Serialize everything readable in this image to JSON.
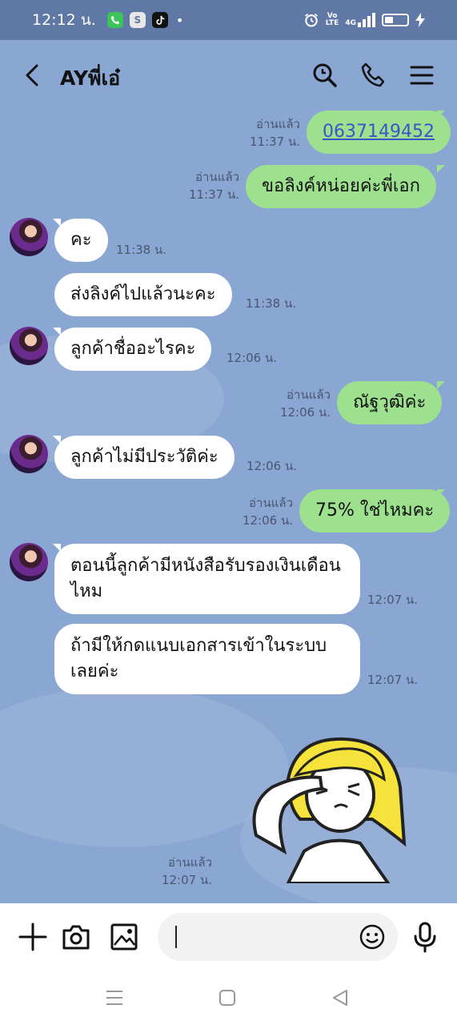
{
  "status_bar": {
    "time": "12:12 น.",
    "apps": [
      "phone-app-icon",
      "s-app-icon",
      "tiktok-icon"
    ],
    "s_app_letter": "S",
    "volte_top": "Vo",
    "volte_bottom": "LTE",
    "network": "4G",
    "dot": "•"
  },
  "header": {
    "title": "AYพี่เอ๋",
    "icons": [
      "back-icon",
      "search-icon",
      "phone-icon",
      "menu-icon"
    ]
  },
  "messages": [
    {
      "side": "out",
      "text": "0637149452",
      "link": true,
      "read": "อ่านแล้ว",
      "time": "11:37 น."
    },
    {
      "side": "out",
      "text": "ขอลิงค์หน่อยค่ะพี่เอก",
      "read": "อ่านแล้ว",
      "time": "11:37 น."
    },
    {
      "side": "in",
      "text": "คะ",
      "time": "11:38 น."
    },
    {
      "side": "in",
      "text": "ส่งลิงค์ไปแล้วนะคะ",
      "time": "11:38 น."
    },
    {
      "side": "in",
      "text": "ลูกค้าชื่ออะไรคะ",
      "time": "12:06 น."
    },
    {
      "side": "out",
      "text": "ณัฐวุฒิค่ะ",
      "read": "อ่านแล้ว",
      "time": "12:06 น."
    },
    {
      "side": "in",
      "text": "ลูกค้าไม่มีประวัติค่ะ",
      "time": "12:06 น."
    },
    {
      "side": "out",
      "text": "75% ใช่ไหมคะ",
      "read": "อ่านแล้ว",
      "time": "12:06 น."
    },
    {
      "side": "in",
      "text": "ตอนนี้ลูกค้ามีหนังสือรับรองเงินเดือนไหม",
      "time": "12:07 น."
    },
    {
      "side": "in",
      "text": "ถ้ามีให้กดแนบเอกสารเข้าในระบบเลยค่ะ",
      "time": "12:07 น."
    },
    {
      "side": "out",
      "sticker": "saluting-character-sticker",
      "read": "อ่านแล้ว",
      "time": "12:07 น."
    }
  ],
  "input_bar": {
    "placeholder": "",
    "icons": [
      "plus-icon",
      "camera-icon",
      "image-icon",
      "emoji-icon",
      "microphone-icon"
    ]
  },
  "nav_bar": {
    "icons": [
      "recent-apps-icon",
      "home-icon",
      "back-nav-icon"
    ]
  },
  "colors": {
    "chat_background": "#8aa6d3",
    "outgoing_bubble": "#9de08e",
    "incoming_bubble": "#ffffff",
    "status_bar": "#5f78a5",
    "link": "#3b55c9"
  }
}
